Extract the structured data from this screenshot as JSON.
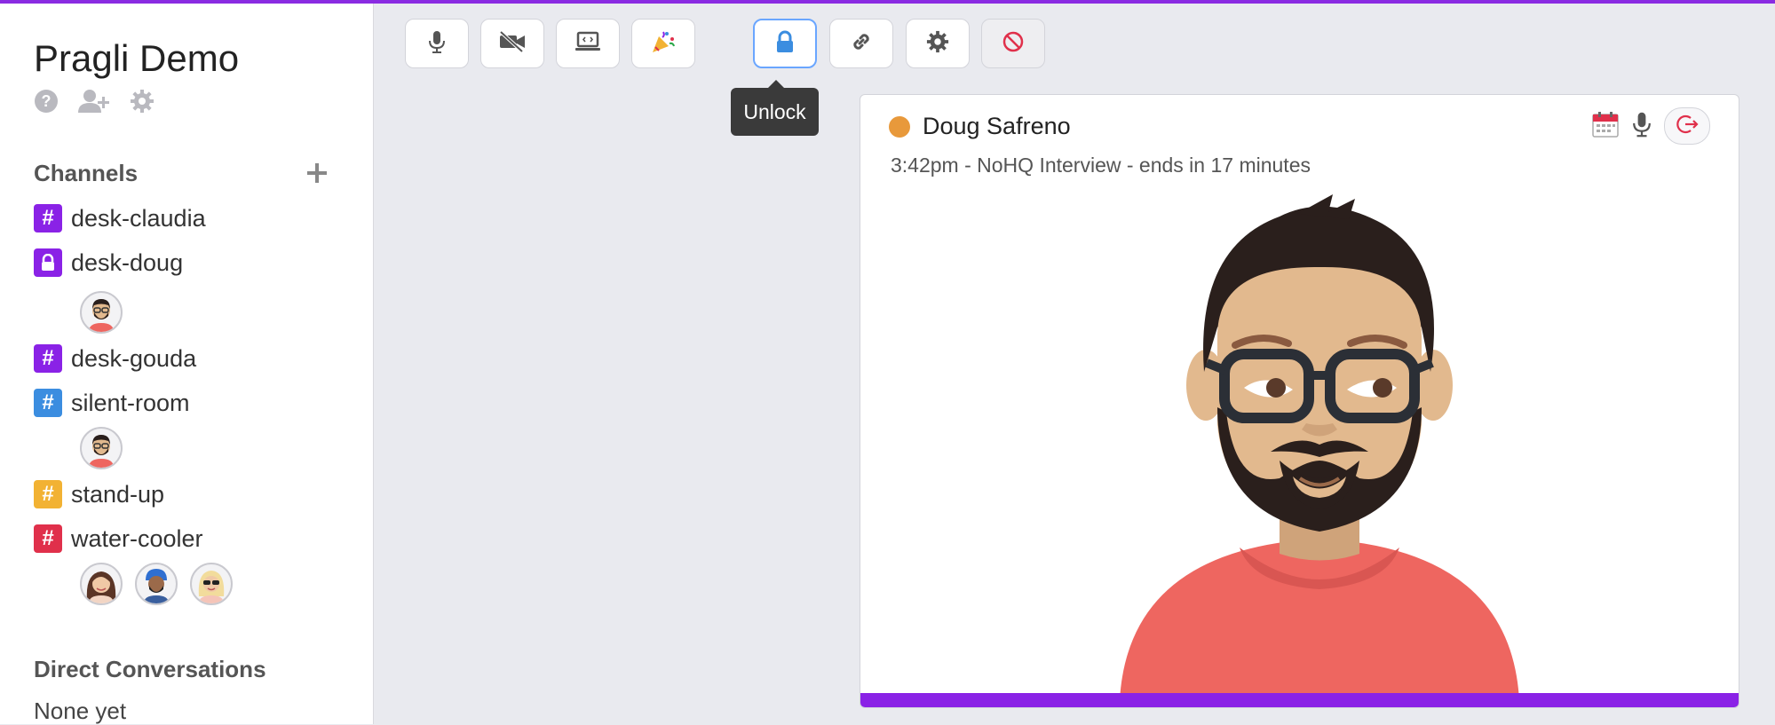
{
  "app": {
    "workspace_title": "Pragli Demo",
    "accent_color": "#8a2be2"
  },
  "sidebar": {
    "workspace_icons": [
      "help-icon",
      "add-user-icon",
      "gear-icon"
    ],
    "channels_title": "Channels",
    "channels": [
      {
        "name": "desk-claudia",
        "icon": "#",
        "color": "#8a22e6",
        "locked": false
      },
      {
        "name": "desk-doug",
        "icon": "lock",
        "color": "#8a22e6",
        "locked": true
      },
      {
        "name": "desk-gouda",
        "icon": "#",
        "color": "#8a22e6",
        "locked": false
      },
      {
        "name": "silent-room",
        "icon": "#",
        "color": "#3b8de0",
        "locked": false
      },
      {
        "name": "stand-up",
        "icon": "#",
        "color": "#f2b233",
        "locked": false
      },
      {
        "name": "water-cooler",
        "icon": "#",
        "color": "#e0304b",
        "locked": false
      }
    ],
    "dm_title": "Direct Conversations",
    "dm_empty": "None yet"
  },
  "toolbar": {
    "buttons": [
      "microphone-icon",
      "video-off-icon",
      "screen-share-icon",
      "party-popper-icon",
      "lock-icon",
      "link-icon",
      "gear-icon",
      "block-icon"
    ],
    "active": "lock-icon",
    "tooltip": "Unlock"
  },
  "video_card": {
    "name": "Doug Safreno",
    "presence_color": "#e8993b",
    "status": "3:42pm - NoHQ Interview - ends in 17 minutes",
    "icons": [
      "calendar-icon",
      "microphone-icon",
      "leave-icon"
    ]
  }
}
